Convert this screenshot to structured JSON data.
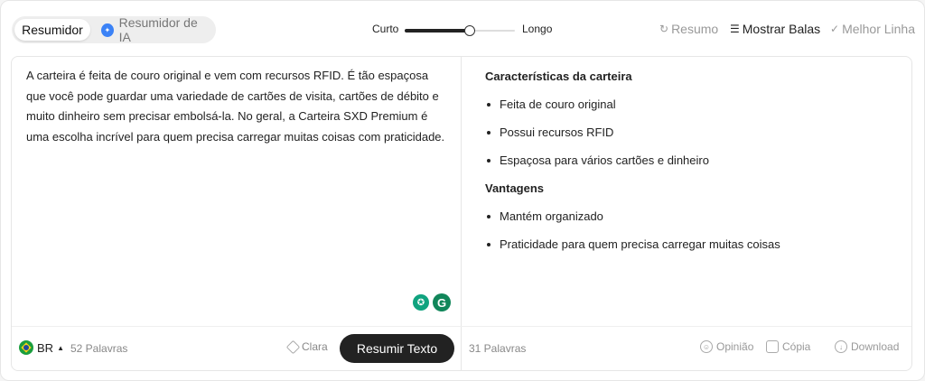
{
  "modes": {
    "summarizer": "Resumidor",
    "ai_summarizer": "Resumidor de IA"
  },
  "length": {
    "short": "Curto",
    "long": "Longo",
    "level": 0.6
  },
  "toolbar": {
    "summary": "Resumo",
    "show_bullets": "Mostrar Balas",
    "best_line": "Melhor Linha"
  },
  "input_text": "A carteira é feita de couro original e vem com recursos RFID. É tão espaçosa que você pode guardar uma variedade de cartões de visita, cartões de débito e muito dinheiro sem precisar embolsá-la. No geral, a Carteira SXD Premium é uma escolha incrível para quem precisa carregar muitas coisas com praticidade.",
  "output": {
    "section1_title": "Características da carteira",
    "section1_items": [
      "Feita de couro original",
      "Possui recursos RFID",
      "Espaçosa para vários cartões e dinheiro"
    ],
    "section2_title": "Vantagens",
    "section2_items": [
      "Mantém organizado",
      "Praticidade para quem precisa carregar muitas coisas"
    ]
  },
  "footer_left": {
    "lang": "BR",
    "word_count": "52 Palavras",
    "clear": "Clara",
    "submit": "Resumir Texto"
  },
  "footer_right": {
    "word_count": "31 Palavras",
    "feedback": "Opinião",
    "copy": "Cópia",
    "download": "Download"
  },
  "icons": [
    "ai-sparkle-icon",
    "summary-icon",
    "bullets-icon",
    "best-line-icon",
    "brazil-flag-icon",
    "caret-up-icon",
    "eraser-icon",
    "feedback-icon",
    "copy-icon",
    "download-icon",
    "grammar-bulb-icon",
    "grammarly-icon"
  ],
  "colors": {
    "accent": "#222222",
    "ai_blue": "#3b82f6",
    "grammarly_green": "#11865a"
  }
}
